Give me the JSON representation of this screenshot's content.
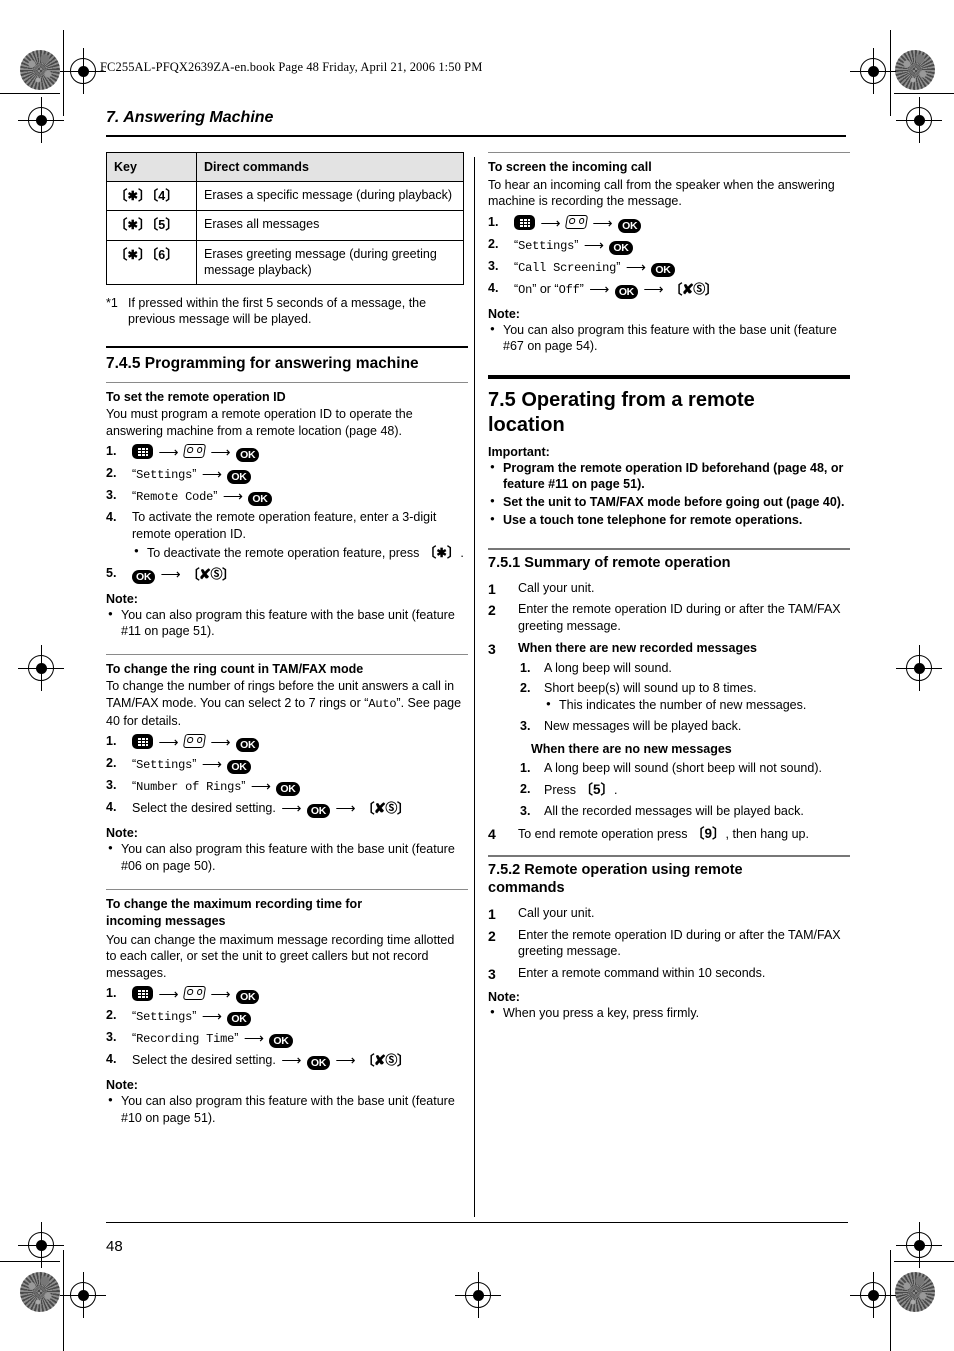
{
  "file_header": "FC255AL-PFQX2639ZA-en.book  Page 48  Friday, April 21, 2006  1:50 PM",
  "chapter_title": "7. Answering Machine",
  "page_number": "48",
  "left_column": {
    "key_table": {
      "headers": [
        "Key",
        "Direct commands"
      ],
      "rows": [
        {
          "key": "{*}{4}",
          "command": "Erases a specific message (during playback)"
        },
        {
          "key": "{*}{5}",
          "command": "Erases all messages"
        },
        {
          "key": "{*}{6}",
          "command": "Erases greeting message (during greeting message playback)"
        }
      ]
    },
    "footnote_mark": "*1",
    "footnote_text": "If pressed within the first 5 seconds of a message, the previous message will be played.",
    "section_745_title": "7.4.5 Programming for answering machine",
    "remote_id": {
      "heading": "To set the remote operation ID",
      "body": "You must program a remote operation ID to operate the answering machine from a remote location (page 48).",
      "steps": [
        {
          "num": "1.",
          "type": "icons_menu_tape_ok"
        },
        {
          "num": "2.",
          "type": "quote_ok",
          "quote": "Settings"
        },
        {
          "num": "3.",
          "type": "quote_ok",
          "quote": "Remote Code"
        },
        {
          "num": "4.",
          "type": "text",
          "text": "To activate the remote operation feature, enter a 3-digit remote operation ID.",
          "bullet": "To deactivate the remote operation feature, press {*}."
        },
        {
          "num": "5.",
          "type": "ok_off"
        }
      ],
      "note_label": "Note:",
      "note": "You can also program this feature with the base unit (feature #11 on page 51)."
    },
    "ring_count": {
      "heading": "To change the ring count in TAM/FAX mode",
      "body_1": "To change the number of rings before the unit answers a call in TAM/FAX mode. You can select 2 to 7 rings or ",
      "body_auto": "Auto",
      "body_2": ". See page 40 for details.",
      "steps": [
        {
          "num": "1.",
          "type": "icons_menu_tape_ok"
        },
        {
          "num": "2.",
          "type": "quote_ok",
          "quote": "Settings"
        },
        {
          "num": "3.",
          "type": "quote_ok",
          "quote": "Number of Rings"
        },
        {
          "num": "4.",
          "type": "select_ok_off",
          "text": "Select the desired setting."
        }
      ],
      "note_label": "Note:",
      "note": "You can also program this feature with the base unit (feature #06 on page 50)."
    },
    "recording_time": {
      "heading_line1": "To change the maximum recording time for",
      "heading_line2": "incoming messages",
      "body": "You can change the maximum message recording time allotted to each caller, or set the unit to greet callers but not record messages.",
      "steps": [
        {
          "num": "1.",
          "type": "icons_menu_tape_ok"
        },
        {
          "num": "2.",
          "type": "quote_ok",
          "quote": "Settings"
        },
        {
          "num": "3.",
          "type": "quote_ok",
          "quote": "Recording Time"
        },
        {
          "num": "4.",
          "type": "select_ok_off",
          "text": "Select the desired setting."
        }
      ],
      "note_label": "Note:",
      "note": "You can also program this feature with the base unit (feature #10 on page 51)."
    }
  },
  "right_column": {
    "screen_call": {
      "heading": "To screen the incoming call",
      "body": "To hear an incoming call from the speaker when the answering machine is recording the message.",
      "steps": [
        {
          "num": "1.",
          "type": "icons_menu_tape_ok"
        },
        {
          "num": "2.",
          "type": "quote_ok",
          "quote": "Settings"
        },
        {
          "num": "3.",
          "type": "quote_ok",
          "quote": "Call Screening"
        },
        {
          "num": "4.",
          "type": "onoff_ok_off",
          "on": "On",
          "or": " or ",
          "off": "Off"
        }
      ],
      "note_label": "Note:",
      "note": "You can also program this feature with the base unit (feature #67 on page 54)."
    },
    "section_75_title_line1": "7.5 Operating from a remote",
    "section_75_title_line2": "location",
    "important_label": "Important:",
    "important_items": [
      "Program the remote operation ID beforehand (page 48, or feature #11 on page 51).",
      "Set the unit to TAM/FAX mode before going out (page 40).",
      "Use a touch tone telephone for remote operations."
    ],
    "section_751_title": "7.5.1 Summary of remote operation",
    "summary_steps": [
      {
        "num": "1",
        "text": "Call your unit."
      },
      {
        "num": "2",
        "text": "Enter the remote operation ID during or after the TAM/FAX greeting message."
      }
    ],
    "step3_num": "3",
    "step3_heading_new": "When there are new recorded messages",
    "step3_new_substeps": [
      {
        "num": "1.",
        "text": "A long beep will sound."
      },
      {
        "num": "2.",
        "text": "Short beep(s) will sound up to 8 times.",
        "bullet": "This indicates the number of new messages."
      },
      {
        "num": "3.",
        "text": "New messages will be played back."
      }
    ],
    "step3_heading_nonew": "When there are no new messages",
    "step3_nonew_substeps": [
      {
        "num": "1.",
        "text": "A long beep will sound (short beep will not sound)."
      },
      {
        "num": "2.",
        "text_pre": "Press ",
        "key": "{5}",
        "text_post": "."
      },
      {
        "num": "3.",
        "text": "All the recorded messages will be played back."
      }
    ],
    "step4_num": "4",
    "step4_text_pre": "To end remote operation press ",
    "step4_key": "{9}",
    "step4_text_post": ", then hang up.",
    "section_752_title_line1": "7.5.2 Remote operation using remote",
    "section_752_title_line2": "commands",
    "remote_cmd_steps": [
      {
        "num": "1",
        "text": "Call your unit."
      },
      {
        "num": "2",
        "text": "Enter the remote operation ID during or after the TAM/FAX greeting message."
      },
      {
        "num": "3",
        "text": "Enter a remote command within 10 seconds."
      }
    ],
    "note_label": "Note:",
    "note": "When you press a key, press firmly."
  },
  "icons": {
    "menu": "menu-keypad-icon",
    "tape": "answering-machine-tape-icon",
    "ok": "OK",
    "arrow": "→",
    "power_off": "phone-off-power-icon"
  }
}
